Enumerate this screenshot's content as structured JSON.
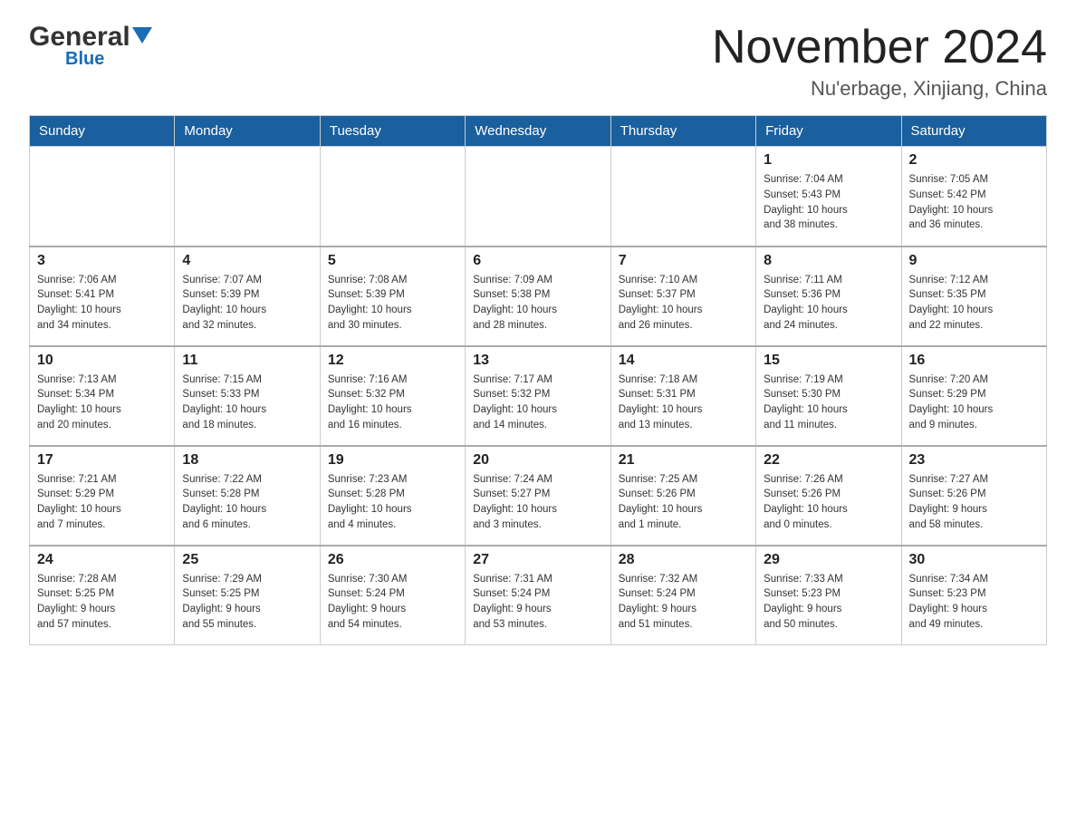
{
  "header": {
    "logo_general": "General",
    "logo_blue": "Blue",
    "title": "November 2024",
    "subtitle": "Nu'erbage, Xinjiang, China"
  },
  "weekdays": [
    "Sunday",
    "Monday",
    "Tuesday",
    "Wednesday",
    "Thursday",
    "Friday",
    "Saturday"
  ],
  "weeks": [
    [
      {
        "day": "",
        "info": ""
      },
      {
        "day": "",
        "info": ""
      },
      {
        "day": "",
        "info": ""
      },
      {
        "day": "",
        "info": ""
      },
      {
        "day": "",
        "info": ""
      },
      {
        "day": "1",
        "info": "Sunrise: 7:04 AM\nSunset: 5:43 PM\nDaylight: 10 hours\nand 38 minutes."
      },
      {
        "day": "2",
        "info": "Sunrise: 7:05 AM\nSunset: 5:42 PM\nDaylight: 10 hours\nand 36 minutes."
      }
    ],
    [
      {
        "day": "3",
        "info": "Sunrise: 7:06 AM\nSunset: 5:41 PM\nDaylight: 10 hours\nand 34 minutes."
      },
      {
        "day": "4",
        "info": "Sunrise: 7:07 AM\nSunset: 5:39 PM\nDaylight: 10 hours\nand 32 minutes."
      },
      {
        "day": "5",
        "info": "Sunrise: 7:08 AM\nSunset: 5:39 PM\nDaylight: 10 hours\nand 30 minutes."
      },
      {
        "day": "6",
        "info": "Sunrise: 7:09 AM\nSunset: 5:38 PM\nDaylight: 10 hours\nand 28 minutes."
      },
      {
        "day": "7",
        "info": "Sunrise: 7:10 AM\nSunset: 5:37 PM\nDaylight: 10 hours\nand 26 minutes."
      },
      {
        "day": "8",
        "info": "Sunrise: 7:11 AM\nSunset: 5:36 PM\nDaylight: 10 hours\nand 24 minutes."
      },
      {
        "day": "9",
        "info": "Sunrise: 7:12 AM\nSunset: 5:35 PM\nDaylight: 10 hours\nand 22 minutes."
      }
    ],
    [
      {
        "day": "10",
        "info": "Sunrise: 7:13 AM\nSunset: 5:34 PM\nDaylight: 10 hours\nand 20 minutes."
      },
      {
        "day": "11",
        "info": "Sunrise: 7:15 AM\nSunset: 5:33 PM\nDaylight: 10 hours\nand 18 minutes."
      },
      {
        "day": "12",
        "info": "Sunrise: 7:16 AM\nSunset: 5:32 PM\nDaylight: 10 hours\nand 16 minutes."
      },
      {
        "day": "13",
        "info": "Sunrise: 7:17 AM\nSunset: 5:32 PM\nDaylight: 10 hours\nand 14 minutes."
      },
      {
        "day": "14",
        "info": "Sunrise: 7:18 AM\nSunset: 5:31 PM\nDaylight: 10 hours\nand 13 minutes."
      },
      {
        "day": "15",
        "info": "Sunrise: 7:19 AM\nSunset: 5:30 PM\nDaylight: 10 hours\nand 11 minutes."
      },
      {
        "day": "16",
        "info": "Sunrise: 7:20 AM\nSunset: 5:29 PM\nDaylight: 10 hours\nand 9 minutes."
      }
    ],
    [
      {
        "day": "17",
        "info": "Sunrise: 7:21 AM\nSunset: 5:29 PM\nDaylight: 10 hours\nand 7 minutes."
      },
      {
        "day": "18",
        "info": "Sunrise: 7:22 AM\nSunset: 5:28 PM\nDaylight: 10 hours\nand 6 minutes."
      },
      {
        "day": "19",
        "info": "Sunrise: 7:23 AM\nSunset: 5:28 PM\nDaylight: 10 hours\nand 4 minutes."
      },
      {
        "day": "20",
        "info": "Sunrise: 7:24 AM\nSunset: 5:27 PM\nDaylight: 10 hours\nand 3 minutes."
      },
      {
        "day": "21",
        "info": "Sunrise: 7:25 AM\nSunset: 5:26 PM\nDaylight: 10 hours\nand 1 minute."
      },
      {
        "day": "22",
        "info": "Sunrise: 7:26 AM\nSunset: 5:26 PM\nDaylight: 10 hours\nand 0 minutes."
      },
      {
        "day": "23",
        "info": "Sunrise: 7:27 AM\nSunset: 5:26 PM\nDaylight: 9 hours\nand 58 minutes."
      }
    ],
    [
      {
        "day": "24",
        "info": "Sunrise: 7:28 AM\nSunset: 5:25 PM\nDaylight: 9 hours\nand 57 minutes."
      },
      {
        "day": "25",
        "info": "Sunrise: 7:29 AM\nSunset: 5:25 PM\nDaylight: 9 hours\nand 55 minutes."
      },
      {
        "day": "26",
        "info": "Sunrise: 7:30 AM\nSunset: 5:24 PM\nDaylight: 9 hours\nand 54 minutes."
      },
      {
        "day": "27",
        "info": "Sunrise: 7:31 AM\nSunset: 5:24 PM\nDaylight: 9 hours\nand 53 minutes."
      },
      {
        "day": "28",
        "info": "Sunrise: 7:32 AM\nSunset: 5:24 PM\nDaylight: 9 hours\nand 51 minutes."
      },
      {
        "day": "29",
        "info": "Sunrise: 7:33 AM\nSunset: 5:23 PM\nDaylight: 9 hours\nand 50 minutes."
      },
      {
        "day": "30",
        "info": "Sunrise: 7:34 AM\nSunset: 5:23 PM\nDaylight: 9 hours\nand 49 minutes."
      }
    ]
  ]
}
